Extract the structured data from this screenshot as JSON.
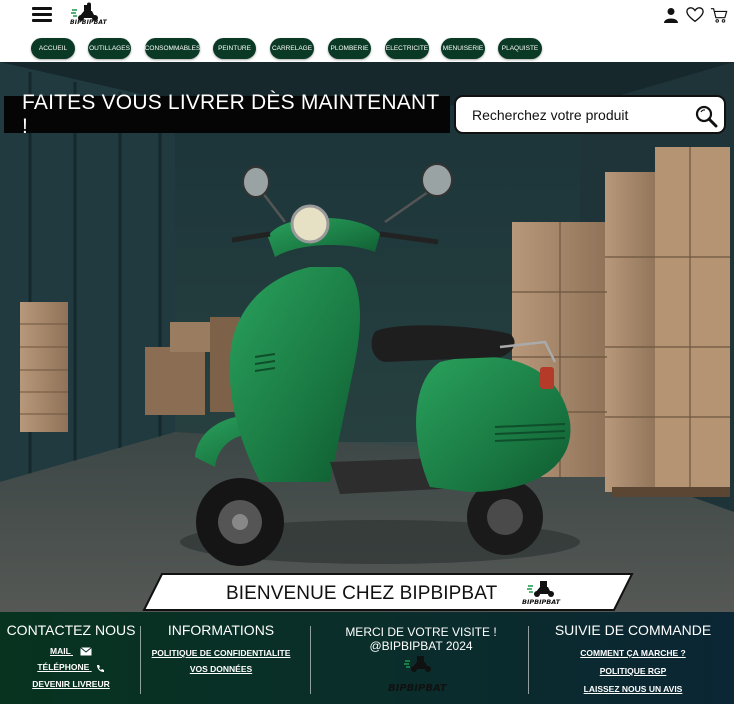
{
  "header": {
    "menu_icon": "hamburger-icon",
    "logo_text": "BIPBIPBAT",
    "icons": [
      "user-icon",
      "heart-icon",
      "cart-icon"
    ]
  },
  "nav": {
    "items": [
      {
        "label": "ACCUEIL"
      },
      {
        "label": "OUTILLAGES"
      },
      {
        "label": "CONSOMMABLES"
      },
      {
        "label": "PEINTURE"
      },
      {
        "label": "CARRELAGE"
      },
      {
        "label": "PLOMBERIE"
      },
      {
        "label": "ELECTRICITE"
      },
      {
        "label": "MENUISERIE"
      },
      {
        "label": "PLAQUISTE"
      }
    ],
    "pill_color": "#0a3a26"
  },
  "hero": {
    "cta": "FAITES VOUS LIVRER DÈS MAINTENANT !",
    "welcome": "BIENVENUE CHEZ BIPBIPBAT",
    "welcome_logo_text": "BIPBIPBAT",
    "scooter_color": "#1f8a4e"
  },
  "search": {
    "placeholder": "Recherchez votre produit",
    "icon": "search-icon"
  },
  "footer": {
    "contact": {
      "heading": "CONTACTEZ NOUS",
      "links": [
        "MAIL",
        "TÉLÉPHONE",
        "DEVENIR LIVREUR"
      ]
    },
    "informations": {
      "heading": "INFORMATIONS",
      "links": [
        "POLITIQUE DE CONFIDENTIALITE",
        "VOS DONNÉES"
      ]
    },
    "message": {
      "line1": "MERCI DE VOTRE VISITE !",
      "line2": "@BIPBIPBAT 2024",
      "logo_text": "BIPBIPBAT"
    },
    "suivi": {
      "heading": "SUIVIE DE COMMANDE",
      "links": [
        "COMMENT ÇA MARCHE ?",
        "POLITIQUE RGP",
        "LAISSEZ NOUS UN AVIS"
      ]
    },
    "accent": "#07331f"
  }
}
